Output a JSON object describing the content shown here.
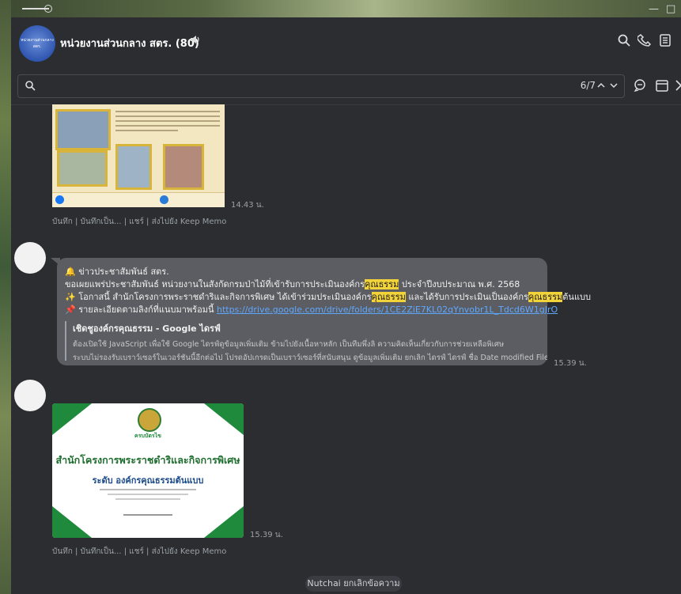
{
  "header": {
    "title": "หน่วยงานส่วนกลาง สตร. (80)",
    "avatar_text": "หน่วยงานส่วนกลาง สตร."
  },
  "window_controls": {
    "minimize": "—",
    "maximize": "□"
  },
  "search": {
    "value": "",
    "count": "6/7",
    "up": "^",
    "down": "v"
  },
  "messages": [
    {
      "type": "image",
      "time": "14.43 น.",
      "actions": "บันทึก | บันทึกเป็น... | แชร์ | ส่งไปยัง Keep Memo"
    },
    {
      "type": "text",
      "time": "15.39 น.",
      "line1": "🔔 ข่าวประชาสัมพันธ์ สตร.",
      "line2_a": "ขอเผยแพร่ประชาสัมพันธ์ หน่วยงานในสังกัดกรมป่าไม้ที่เข้ารับการประเมินองค์กร",
      "line2_hl": "คุณธรรม",
      "line2_b": " ประจำปีงบประมาณ พ.ศ. 2568",
      "line3_a": "✨ โอกาสนี้ สำนักโครงการพระราชดำริและกิจการพิเศษ ได้เข้าร่วมประเมินองค์กร",
      "line3_hl1": "คุณธรรม",
      "line3_b": " และได้รับการประเมินเป็นองค์กร",
      "line3_hl2": "คุณธรรม",
      "line3_c": "ต้นแบบ",
      "line4_a": "📌 รายละเอียดตามลิงก์ที่แนบมาพร้อมนี้ ",
      "line4_link": "https://drive.google.com/drive/folders/1CE2ZiE7KL02qYnvobr1L_Tdcd6W1gJrO",
      "preview_title": "เชิดชูองค์กรคุณธรรม - Google ไดรฟ์",
      "preview_desc1": "ต้องเปิดใช้ JavaScript เพื่อใช้ Google ไดรฟ์ดูข้อมูลเพิ่มเติม ข้ามไปยังเนื้อหาหลัก เป็นทีมพึ่งลิ ความคิดเห็นเกี่ยวกับการช่วยเหลือพิเศษ",
      "preview_desc2": "ระบบไม่รองรับเบราว์เซอร์ในเวอร์ชันนี้อีกต่อไป โปรดอัปเกรดเป็นเบราว์เซอร์ที่สนับสนุน ดูข้อมูลเพิ่มเติม ยกเลิก ไดรฟ์ ไดรฟ์ ชื่อ Date modified File..."
    },
    {
      "type": "image",
      "time": "15.39 น.",
      "actions": "บันทึก | บันทึกเป็น... | แชร์ | ส่งไปยัง Keep Memo",
      "cert_heading": "ครบบัตรไข",
      "cert_org": "สำนักโครงการพระราชดำริและกิจการพิเศษ",
      "cert_level": "ระดับ องค์กรคุณธรรมต้นแบบ"
    }
  ],
  "system_notice": "Nutchai ยกเลิกข้อความ",
  "colors": {
    "highlight": "#f2d33a",
    "link": "#5fa8ff",
    "bubble": "#5b5d62",
    "background": "#2b2d31"
  }
}
